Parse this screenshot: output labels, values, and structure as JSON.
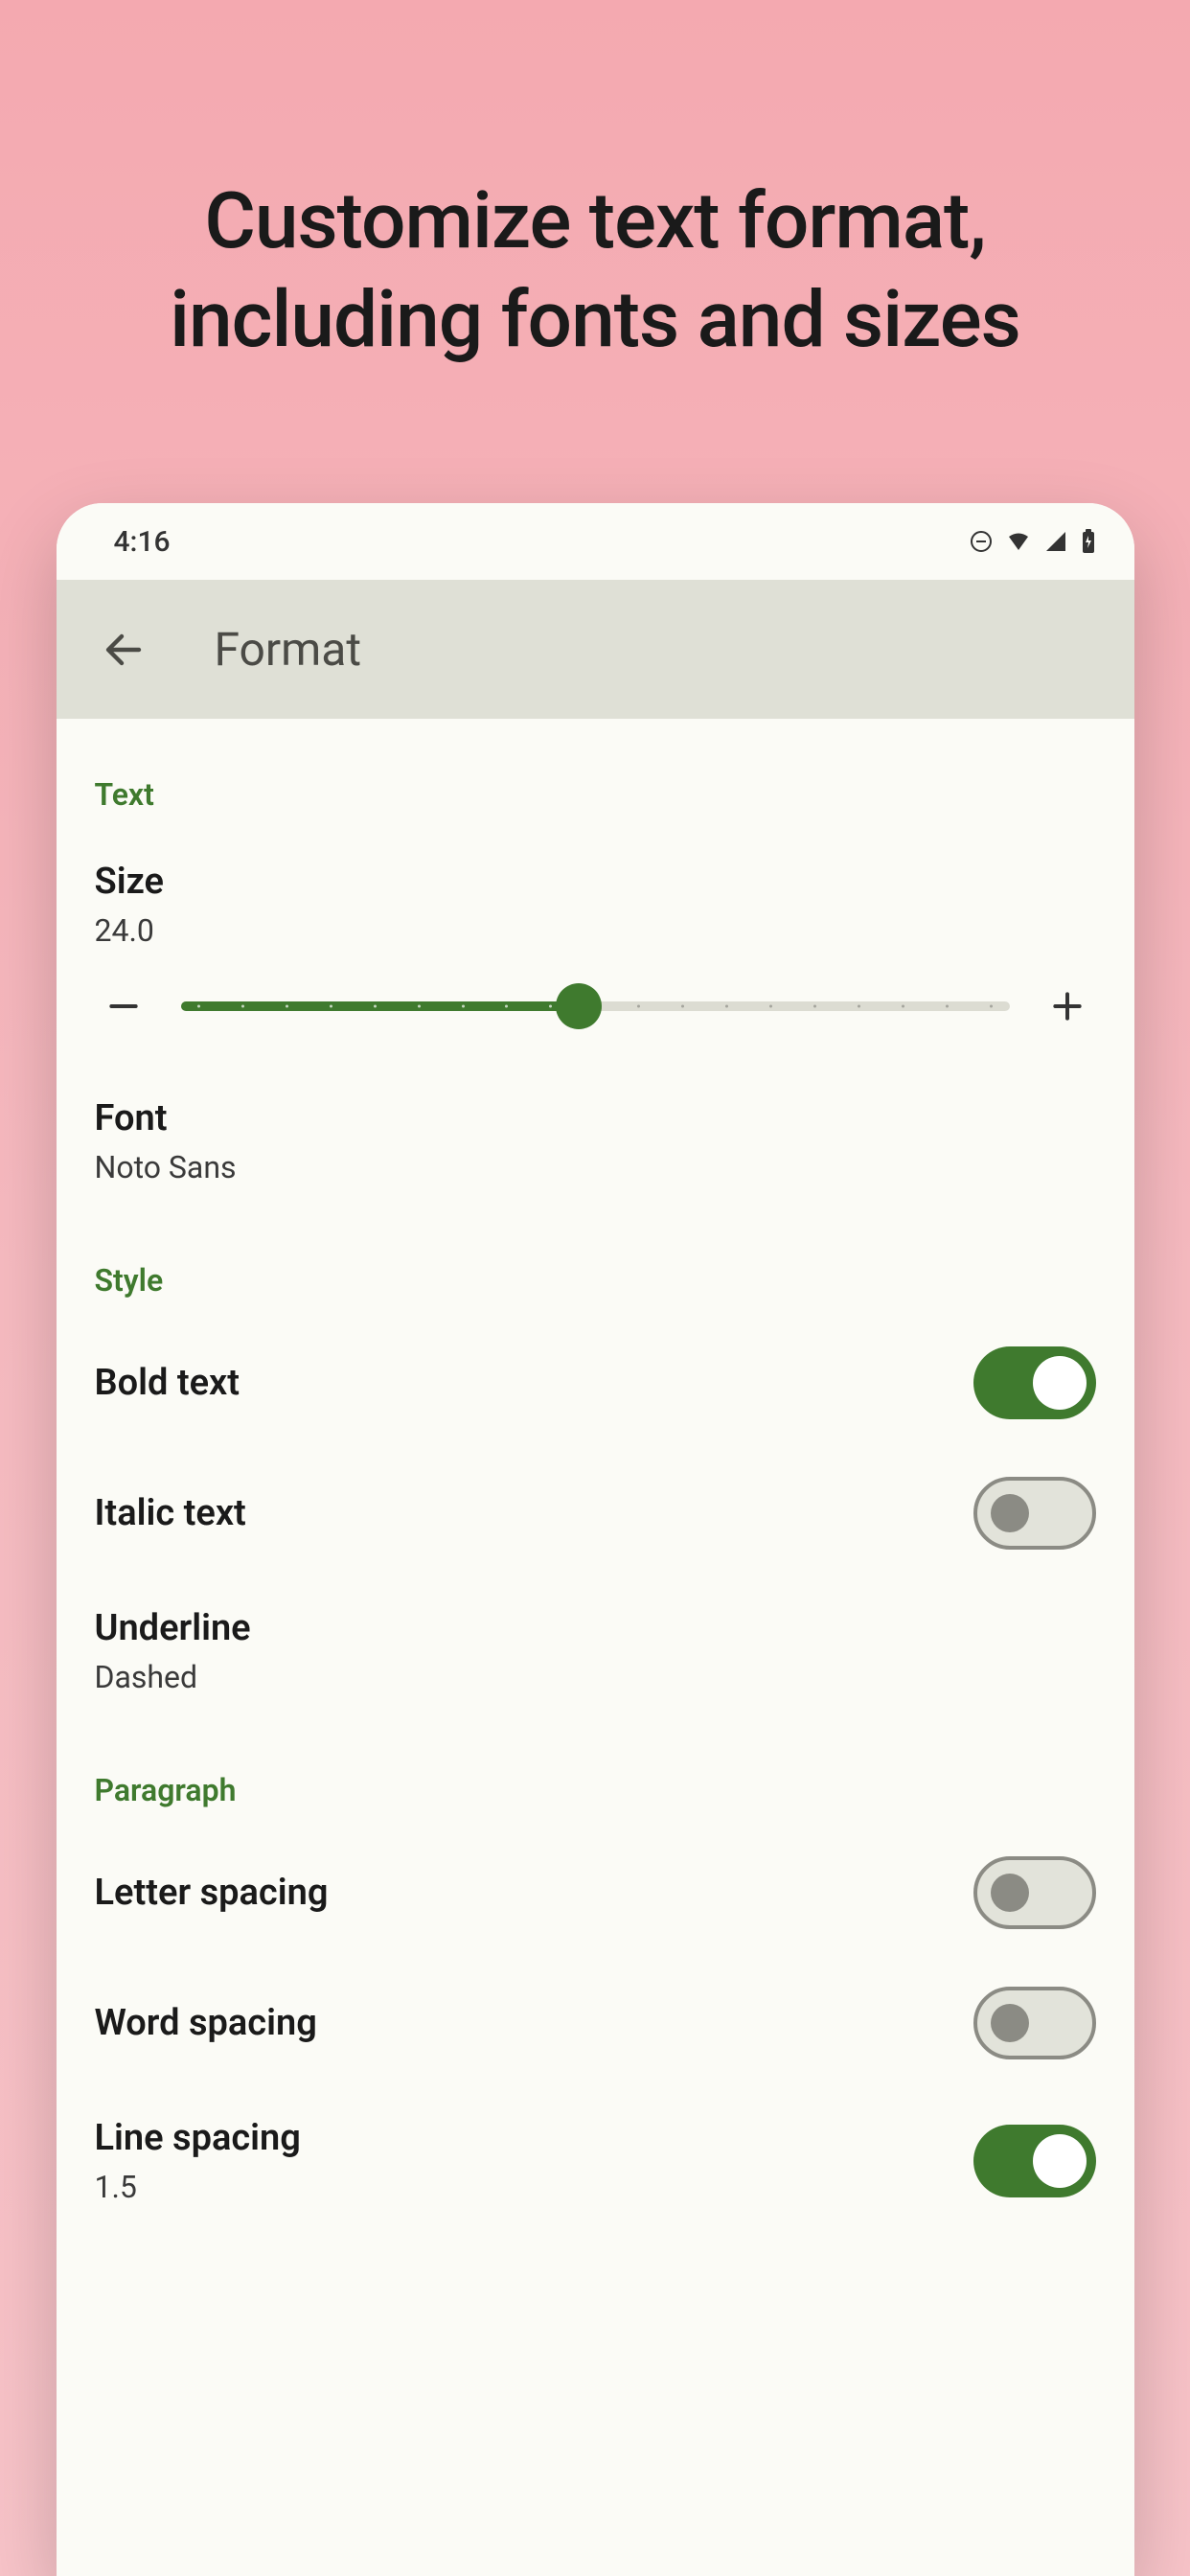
{
  "promo": {
    "headline_line1": "Customize text format,",
    "headline_line2": "including fonts and sizes"
  },
  "status": {
    "time": "4:16"
  },
  "appbar": {
    "title": "Format"
  },
  "sections": {
    "text": {
      "header": "Text",
      "size": {
        "label": "Size",
        "value": "24.0",
        "slider_percent": 48
      },
      "font": {
        "label": "Font",
        "value": "Noto Sans"
      }
    },
    "style": {
      "header": "Style",
      "bold": {
        "label": "Bold text",
        "on": true
      },
      "italic": {
        "label": "Italic text",
        "on": false
      },
      "underline": {
        "label": "Underline",
        "value": "Dashed"
      }
    },
    "paragraph": {
      "header": "Paragraph",
      "letter": {
        "label": "Letter spacing",
        "on": false
      },
      "word": {
        "label": "Word spacing",
        "on": false
      },
      "line": {
        "label": "Line spacing",
        "value": "1.5",
        "on": true
      }
    }
  }
}
